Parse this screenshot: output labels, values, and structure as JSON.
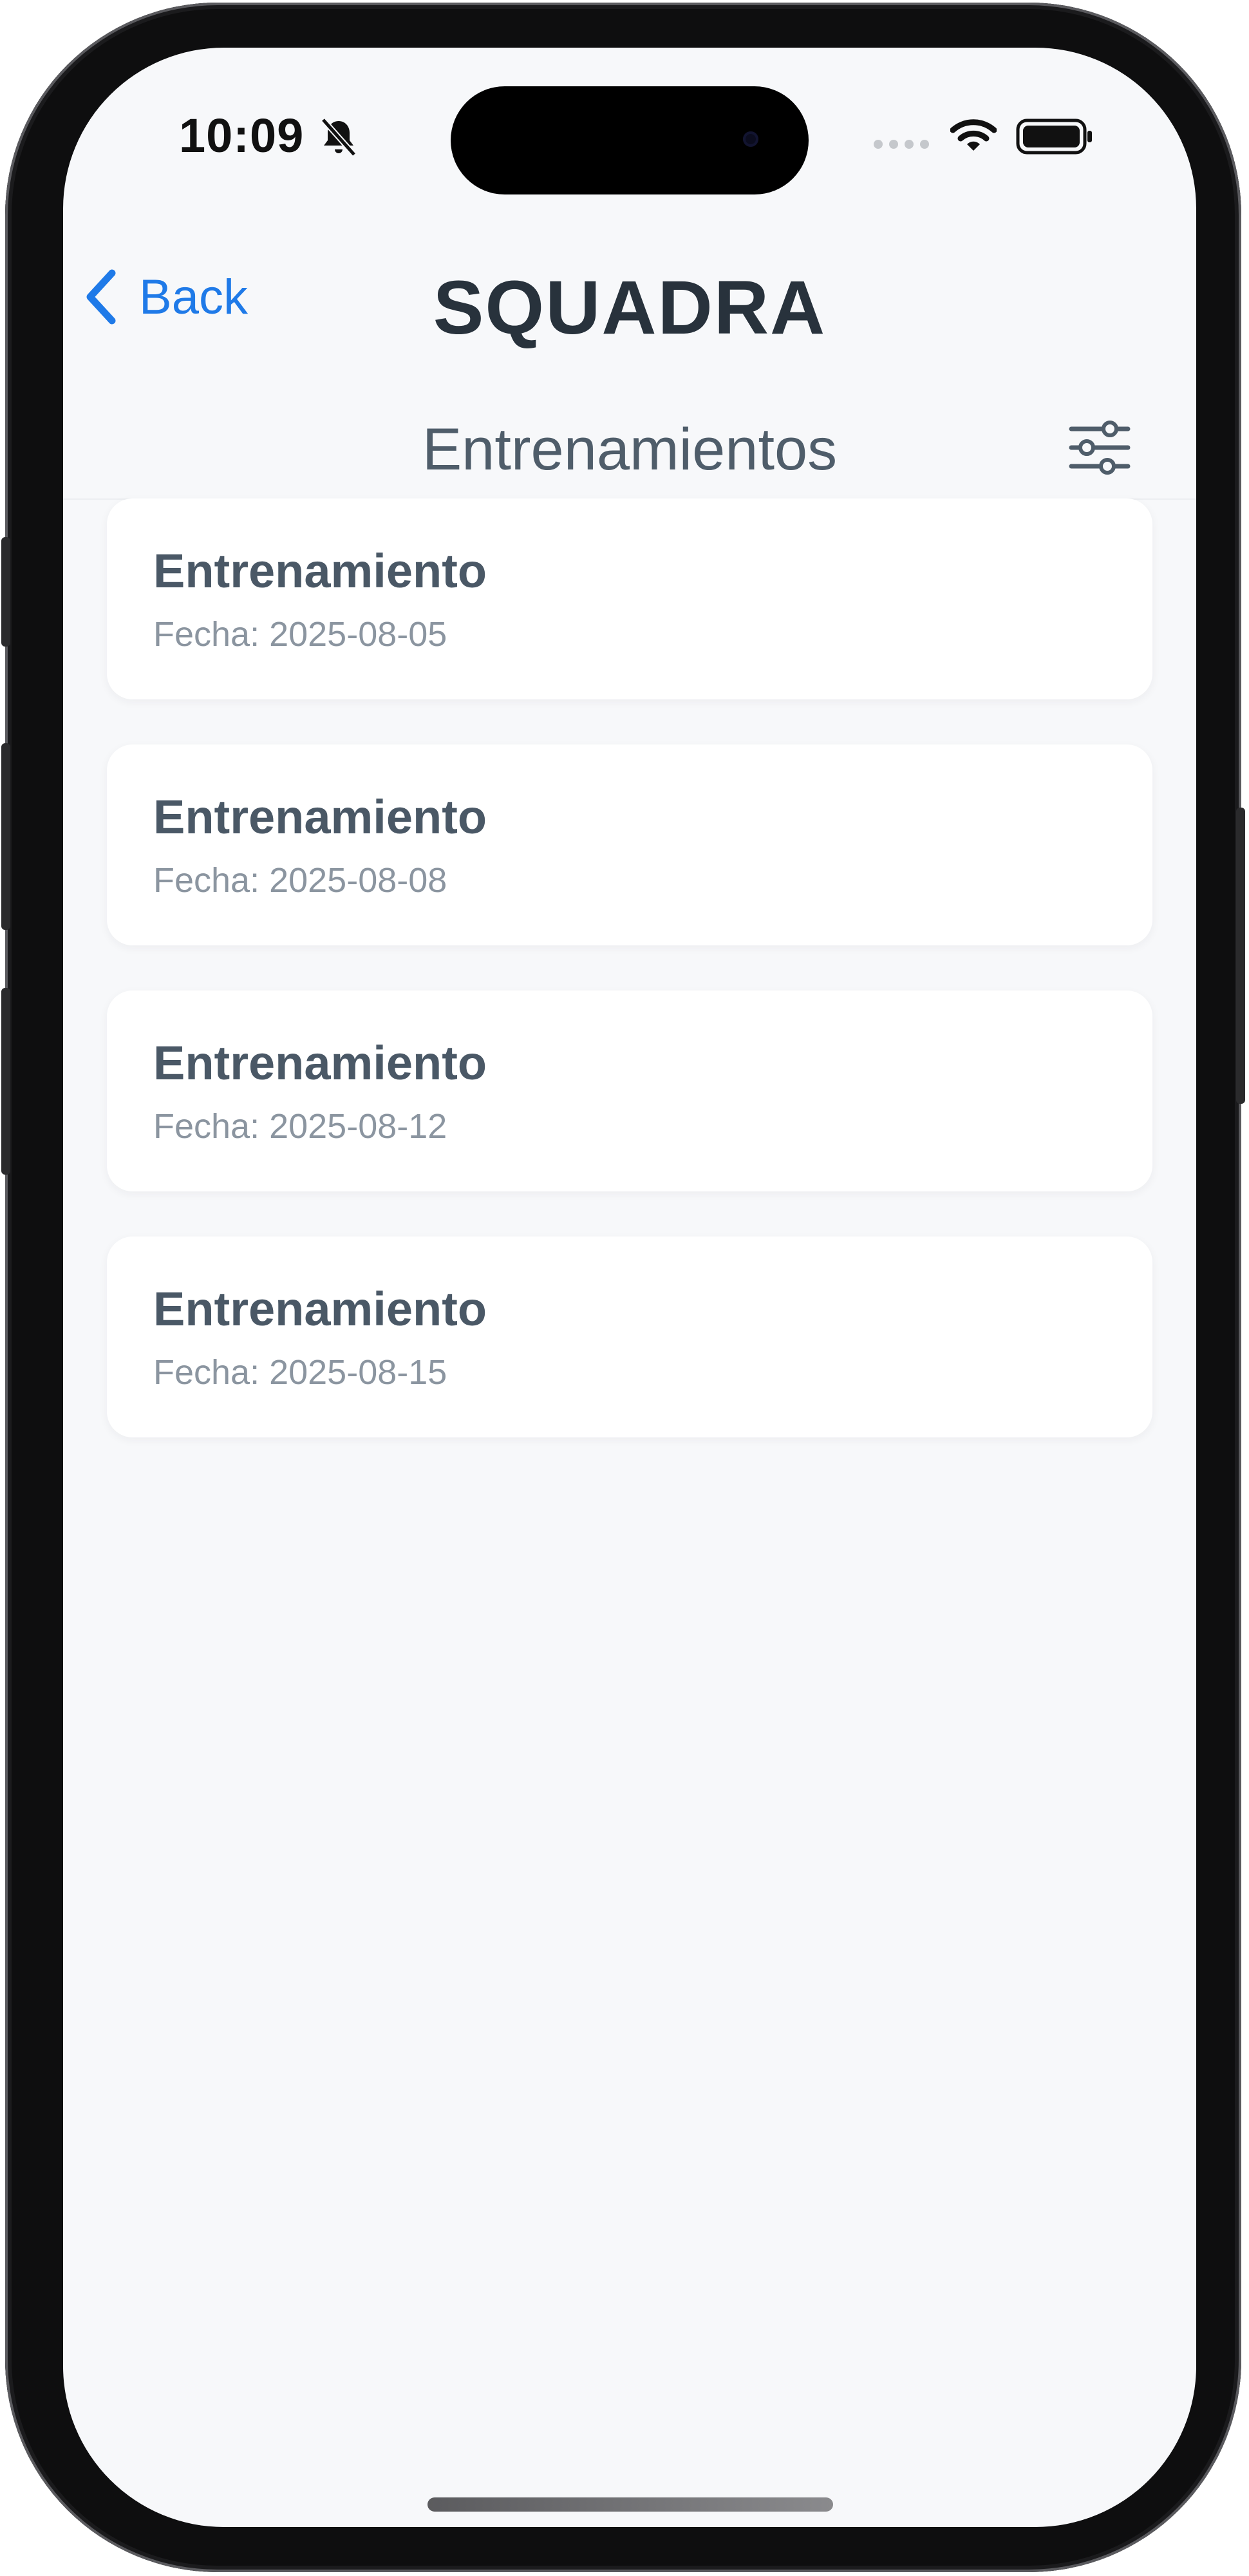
{
  "status_bar": {
    "time": "10:09",
    "icons": [
      "bell-slash-icon",
      "signal-icon",
      "wifi-icon",
      "battery-icon"
    ]
  },
  "nav": {
    "back_label": "Back",
    "app_title": "SQUADRA",
    "accent_color": "#1f7ae8"
  },
  "header": {
    "subtitle": "Entrenamientos",
    "filter_icon": "sliders-icon"
  },
  "trainings": [
    {
      "title": "Entrenamiento",
      "date": "Fecha: 2025-08-05"
    },
    {
      "title": "Entrenamiento",
      "date": "Fecha: 2025-08-08"
    },
    {
      "title": "Entrenamiento",
      "date": "Fecha: 2025-08-12"
    },
    {
      "title": "Entrenamiento",
      "date": "Fecha: 2025-08-15"
    }
  ]
}
